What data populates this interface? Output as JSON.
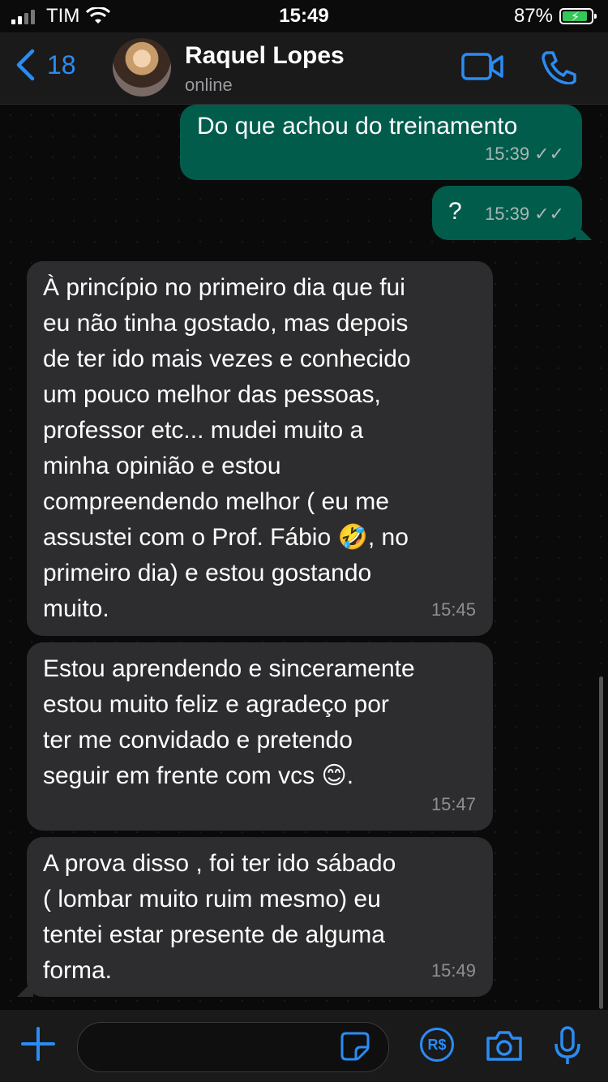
{
  "status_bar": {
    "carrier": "TIM",
    "time": "15:49",
    "battery": "87%"
  },
  "header": {
    "back_count": "18",
    "contact_name": "Raquel Lopes",
    "contact_status": "online"
  },
  "colors": {
    "accent": "#2b8cf3",
    "outgoing_bubble": "#025c4c",
    "incoming_bubble": "#2d2d2f"
  },
  "messages": [
    {
      "direction": "out",
      "text": "Do que achou do treinamento",
      "time": "15:39"
    },
    {
      "direction": "out",
      "text": "?",
      "time": "15:39"
    },
    {
      "direction": "in",
      "text": "À princípio no primeiro dia que fui\neu não tinha gostado, mas depois\nde ter ido mais vezes e conhecido\num pouco melhor das pessoas,\nprofessor etc... mudei muito a\nminha opinião e estou\ncompreendendo melhor ( eu me\nassustei com o Prof. Fábio 🤣, no\nprimeiro dia) e estou gostando\nmuito.",
      "time": "15:45"
    },
    {
      "direction": "in",
      "text": "Estou aprendendo e sinceramente\nestou muito feliz e agradeço por\nter me convidado e pretendo\nseguir em frente com vcs 😊.",
      "time": "15:47"
    },
    {
      "direction": "in",
      "text": "A prova disso , foi ter ido sábado\n( lombar muito ruim mesmo) eu\ntentei estar presente de alguma\nforma.",
      "time": "15:49"
    }
  ],
  "icons": {
    "back": "chevron-left-icon",
    "video": "video-camera-icon",
    "call": "phone-icon",
    "plus": "plus-icon",
    "sticker": "sticker-icon",
    "payment": "payment-icon",
    "camera": "camera-icon",
    "mic": "microphone-icon"
  },
  "input": {
    "payment_label": "R$"
  }
}
